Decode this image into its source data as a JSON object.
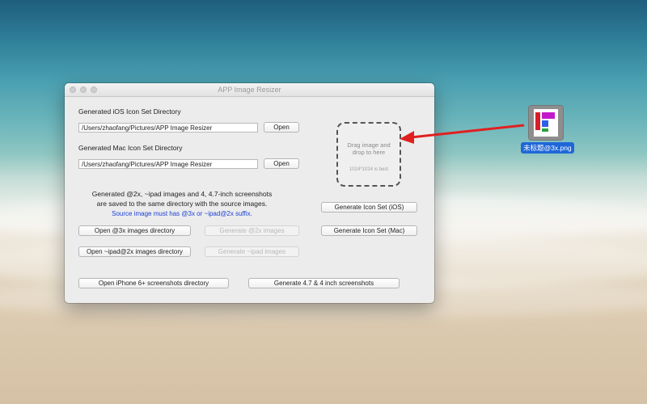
{
  "window": {
    "title": "APP Image Resizer"
  },
  "ios": {
    "label": "Generated iOS Icon Set Directory",
    "path": "/Users/zhaofang/Pictures/APP Image Resizer",
    "open_label": "Open"
  },
  "mac": {
    "label": "Generated Mac Icon Set Directory",
    "path": "/Users/zhaofang/Pictures/APP Image Resizer",
    "open_label": "Open"
  },
  "drop": {
    "line1": "Drag image and",
    "line2": "drop to here",
    "size_hint": "1024*1024 is best"
  },
  "info": {
    "line1": "Generated @2x, ~ipad images and 4, 4.7-inch screenshots",
    "line2": "are saved to the same directory with the source images.",
    "warning": "Source image must has @3x or ~ipad@2x suffix."
  },
  "buttons": {
    "gen_ios": "Generate Icon Set (iOS)",
    "gen_mac": "Generate Icon Set (Mac)",
    "open_3x": "Open @3x images directory",
    "gen_2x": "Generate @2x images",
    "open_ipad": "Open ~ipad@2x images directory",
    "gen_ipad": "Generate ~ipad images",
    "open_iphone6": "Open iPhone 6+ screenshots directory",
    "gen_screens": "Generate 4.7 & 4 inch screenshots"
  },
  "desktop": {
    "file_name": "未标题@3x.png"
  },
  "colors": {
    "arrow": "#e02020",
    "selection": "#1f67d8",
    "warning_text": "#1b3fd8"
  }
}
